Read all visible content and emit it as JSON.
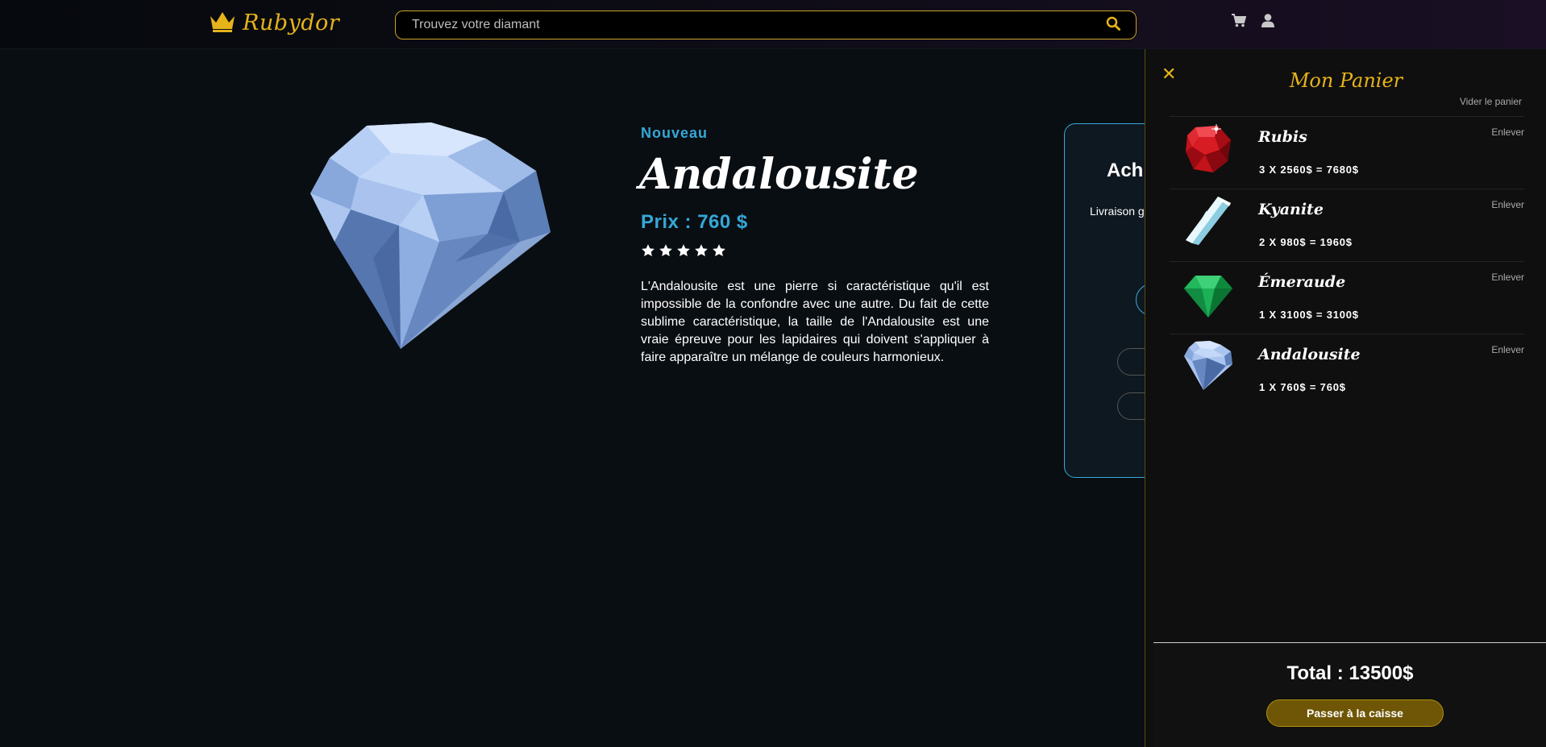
{
  "header": {
    "brand": "Rubydor",
    "search_placeholder": "Trouvez votre diamant",
    "icons": [
      "crown-icon",
      "search-icon",
      "cart-icon",
      "user-icon"
    ]
  },
  "product": {
    "badge": "Nouveau",
    "name": "Andalousite",
    "price": "Prix : 760 $",
    "rating": 5,
    "description": "L'Andalousite est une pierre si caractéristique qu'il est impossible de la confondre avec une autre. Du fait de cette sublime caractéristique, la taille de l'Andalousite est une vraie épreuve pour les lapidaires qui doivent s'appliquer à faire apparaître un mélange de couleurs harmonieux."
  },
  "purchase": {
    "title": "Ach",
    "shipping": "Livraison g"
  },
  "cart": {
    "close": "✕",
    "title": "Mon Panier",
    "clear": "Vider le panier",
    "items": [
      {
        "name": "Rubis",
        "calc": "3 X 2560$ = 7680$",
        "remove": "Enlever",
        "gem": "ruby-image"
      },
      {
        "name": "Kyanite",
        "calc": "2 X 980$ = 1960$",
        "remove": "Enlever",
        "gem": "kyanite-image"
      },
      {
        "name": "Émeraude",
        "calc": "1 X 3100$ = 3100$",
        "remove": "Enlever",
        "gem": "emerald-image"
      },
      {
        "name": "Andalousite",
        "calc": "1 X 760$ = 760$",
        "remove": "Enlever",
        "gem": "diamond-image"
      }
    ],
    "total": "Total : 13500$",
    "checkout": "Passer à la caisse"
  },
  "colors": {
    "gold": "#e6b31a",
    "accent_blue": "#35a7d8",
    "background": "#090e12"
  }
}
